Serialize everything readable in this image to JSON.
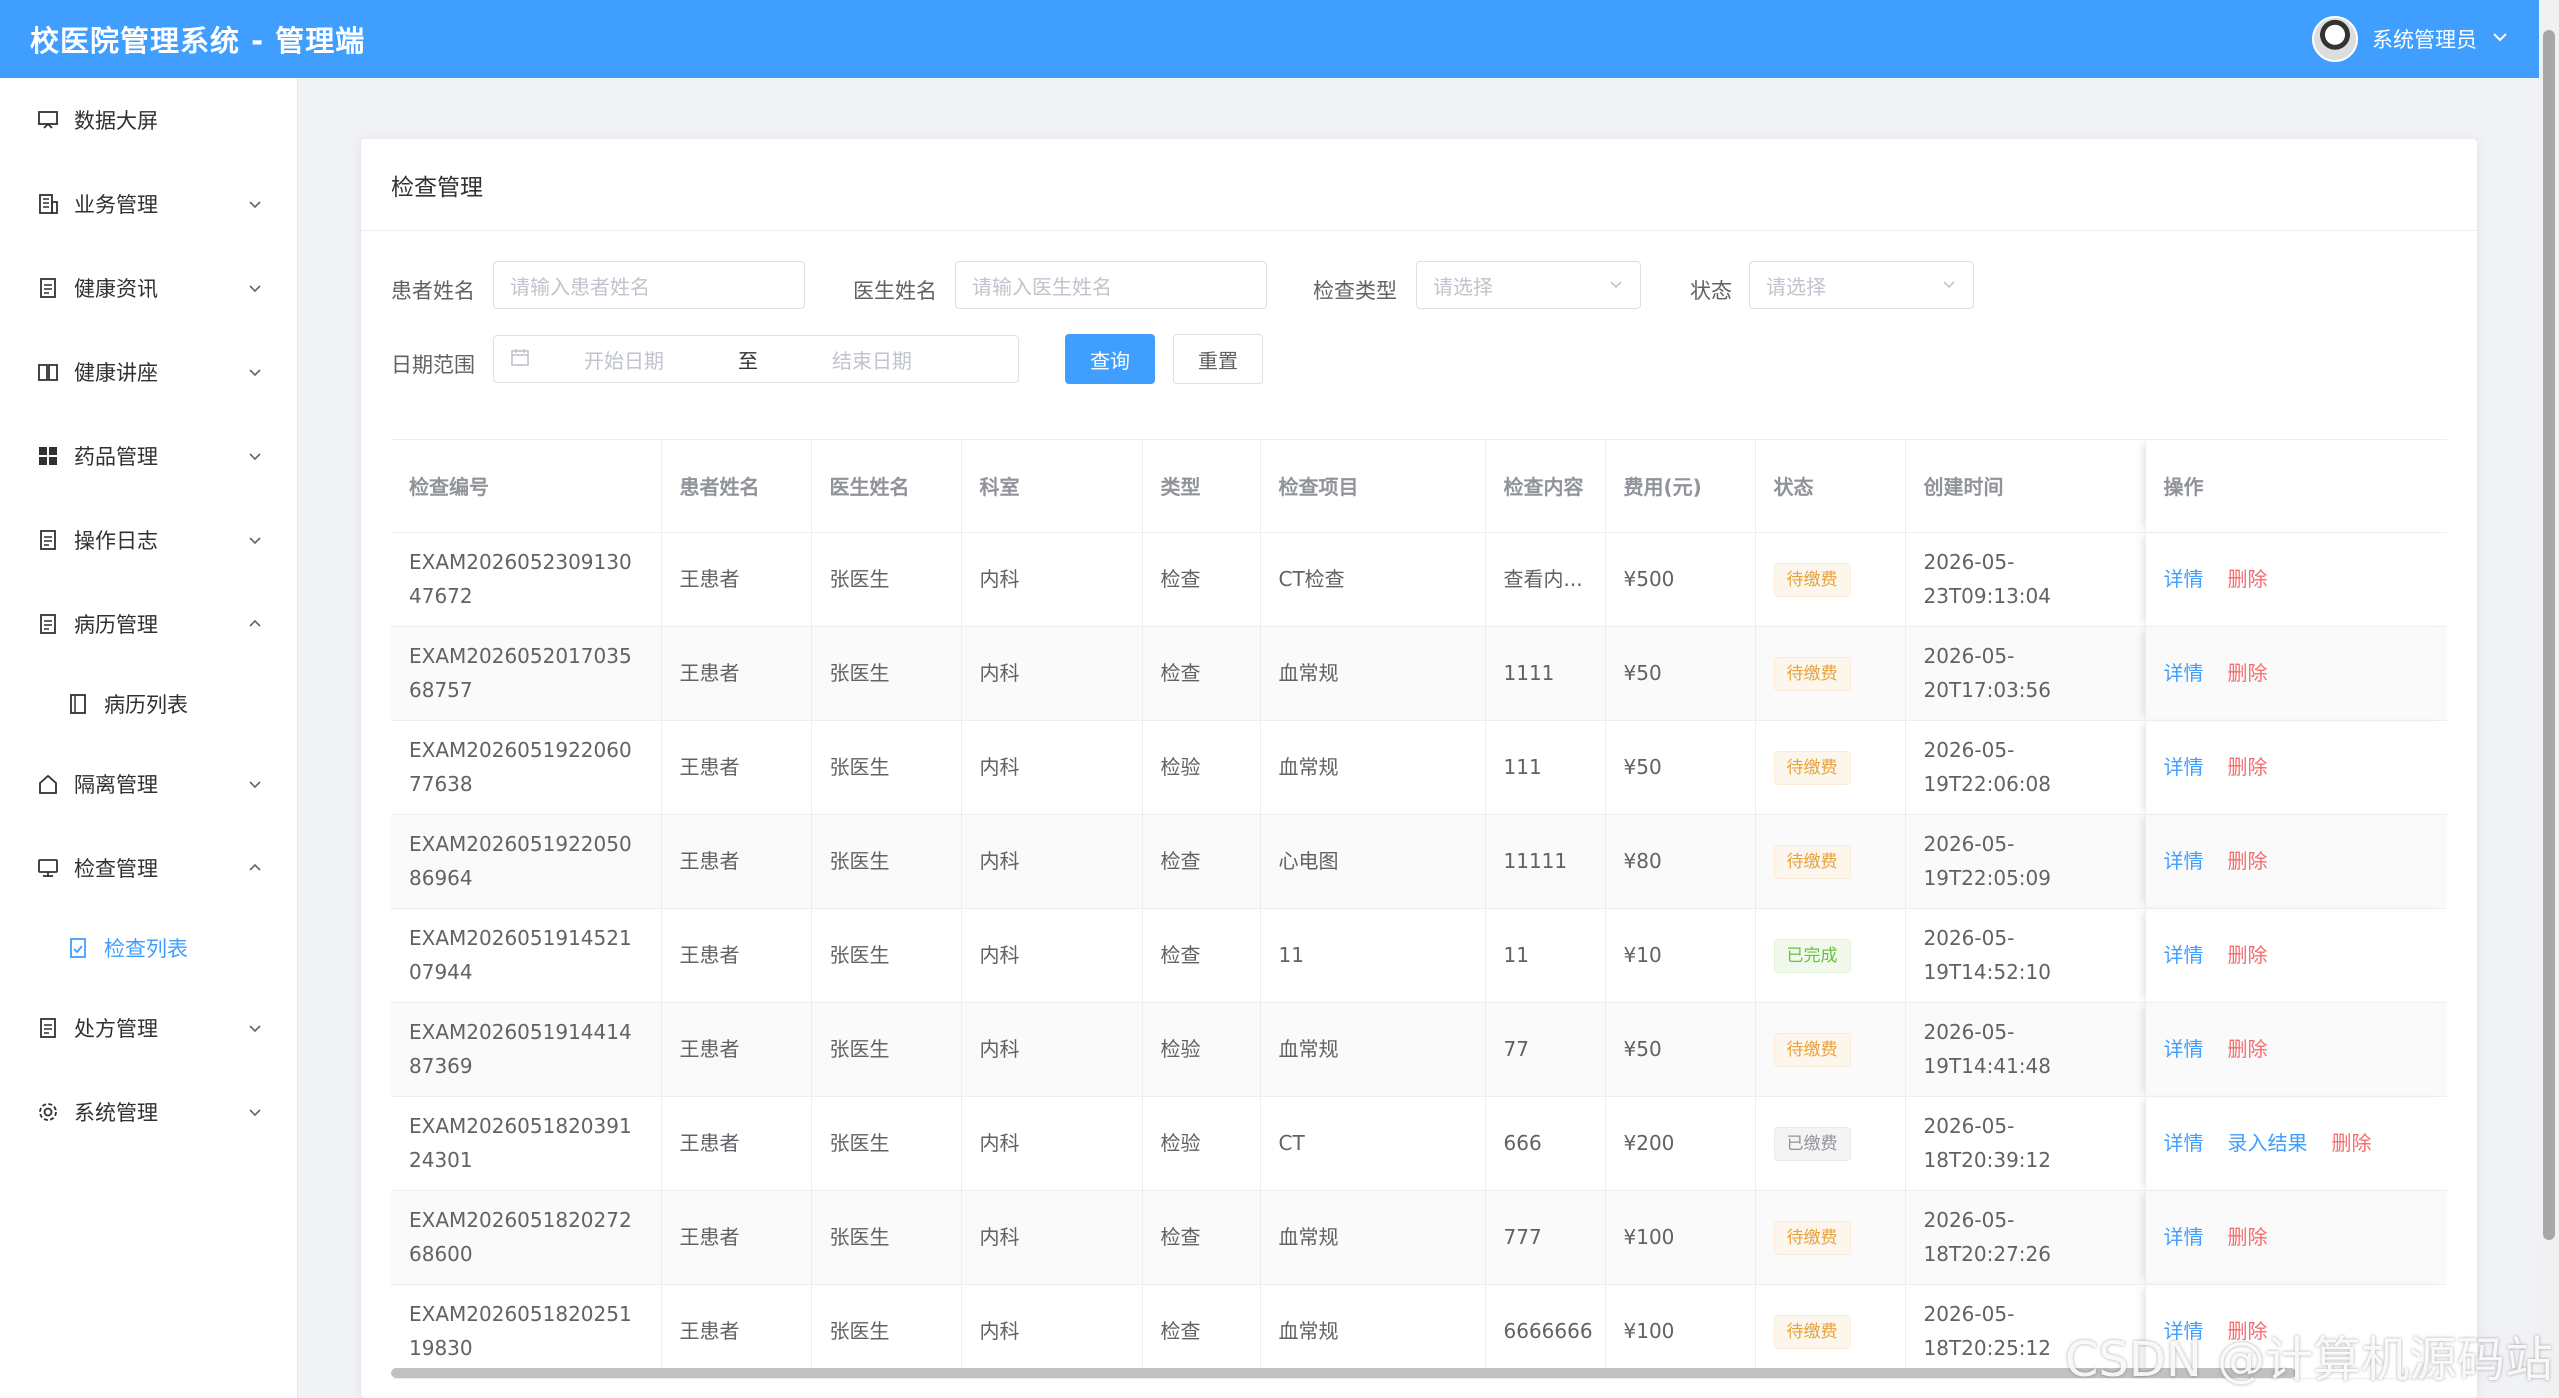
{
  "header": {
    "title": "校医院管理系统 - 管理端",
    "user_name": "系统管理员"
  },
  "sidebar": {
    "items": [
      {
        "label": "数据大屏",
        "icon": "monitor-icon"
      },
      {
        "label": "业务管理",
        "icon": "building-icon"
      },
      {
        "label": "健康资讯",
        "icon": "document-icon"
      },
      {
        "label": "健康讲座",
        "icon": "book-icon"
      },
      {
        "label": "药品管理",
        "icon": "grid-icon"
      },
      {
        "label": "操作日志",
        "icon": "document-icon"
      },
      {
        "label": "病历管理",
        "icon": "document-icon"
      },
      {
        "label": "病历列表",
        "icon": "notebook-icon"
      },
      {
        "label": "隔离管理",
        "icon": "house-icon"
      },
      {
        "label": "检查管理",
        "icon": "monitor-icon"
      },
      {
        "label": "检查列表",
        "icon": "document-check-icon"
      },
      {
        "label": "处方管理",
        "icon": "document-icon"
      },
      {
        "label": "系统管理",
        "icon": "gear-icon"
      }
    ]
  },
  "page": {
    "title": "检查管理"
  },
  "filters": {
    "patient_label": "患者姓名",
    "patient_placeholder": "请输入患者姓名",
    "doctor_label": "医生姓名",
    "doctor_placeholder": "请输入医生姓名",
    "type_label": "检查类型",
    "type_placeholder": "请选择",
    "status_label": "状态",
    "status_placeholder": "请选择",
    "date_label": "日期范围",
    "start_placeholder": "开始日期",
    "range_sep": "至",
    "end_placeholder": "结束日期",
    "query_label": "查询",
    "reset_label": "重置"
  },
  "table": {
    "headers": [
      "检查编号",
      "患者姓名",
      "医生姓名",
      "科室",
      "类型",
      "检查项目",
      "检查内容",
      "费用(元)",
      "状态",
      "创建时间",
      "操作"
    ],
    "rows": [
      {
        "id": "EXAM202605230913047672",
        "patient": "王患者",
        "doctor": "张医生",
        "dept": "内科",
        "type": "检查",
        "item": "CT检查",
        "content": "查看内...",
        "fee": "¥500",
        "status": "待缴费",
        "time": "2026-05-23T09:13:04"
      },
      {
        "id": "EXAM202605201703568757",
        "patient": "王患者",
        "doctor": "张医生",
        "dept": "内科",
        "type": "检查",
        "item": "血常规",
        "content": "1111",
        "fee": "¥50",
        "status": "待缴费",
        "time": "2026-05-20T17:03:56"
      },
      {
        "id": "EXAM202605192206077638",
        "patient": "王患者",
        "doctor": "张医生",
        "dept": "内科",
        "type": "检验",
        "item": "血常规",
        "content": "111",
        "fee": "¥50",
        "status": "待缴费",
        "time": "2026-05-19T22:06:08"
      },
      {
        "id": "EXAM202605192205086964",
        "patient": "王患者",
        "doctor": "张医生",
        "dept": "内科",
        "type": "检查",
        "item": "心电图",
        "content": "11111",
        "fee": "¥80",
        "status": "待缴费",
        "time": "2026-05-19T22:05:09"
      },
      {
        "id": "EXAM202605191452107944",
        "patient": "王患者",
        "doctor": "张医生",
        "dept": "内科",
        "type": "检查",
        "item": "11",
        "content": "11",
        "fee": "¥10",
        "status": "已完成",
        "time": "2026-05-19T14:52:10"
      },
      {
        "id": "EXAM202605191441487369",
        "patient": "王患者",
        "doctor": "张医生",
        "dept": "内科",
        "type": "检验",
        "item": "血常规",
        "content": "77",
        "fee": "¥50",
        "status": "待缴费",
        "time": "2026-05-19T14:41:48"
      },
      {
        "id": "EXAM202605182039124301",
        "patient": "王患者",
        "doctor": "张医生",
        "dept": "内科",
        "type": "检验",
        "item": "CT",
        "content": "666",
        "fee": "¥200",
        "status": "已缴费",
        "time": "2026-05-18T20:39:12"
      },
      {
        "id": "EXAM202605182027268600",
        "patient": "王患者",
        "doctor": "张医生",
        "dept": "内科",
        "type": "检查",
        "item": "血常规",
        "content": "777",
        "fee": "¥100",
        "status": "待缴费",
        "time": "2026-05-18T20:27:26"
      },
      {
        "id": "EXAM202605182025119830",
        "patient": "王患者",
        "doctor": "张医生",
        "dept": "内科",
        "type": "检查",
        "item": "血常规",
        "content": "6666666",
        "fee": "¥100",
        "status": "待缴费",
        "time": "2026-05-18T20:25:12"
      }
    ],
    "op_detail": "详情",
    "op_delete": "删除",
    "op_enter": "录入结果"
  },
  "watermark": "CSDN @计算机源码站",
  "colors": {
    "primary": "#409eff",
    "danger": "#f56c6c",
    "warning": "#e6a23c",
    "success": "#67c23a",
    "info": "#909399"
  }
}
